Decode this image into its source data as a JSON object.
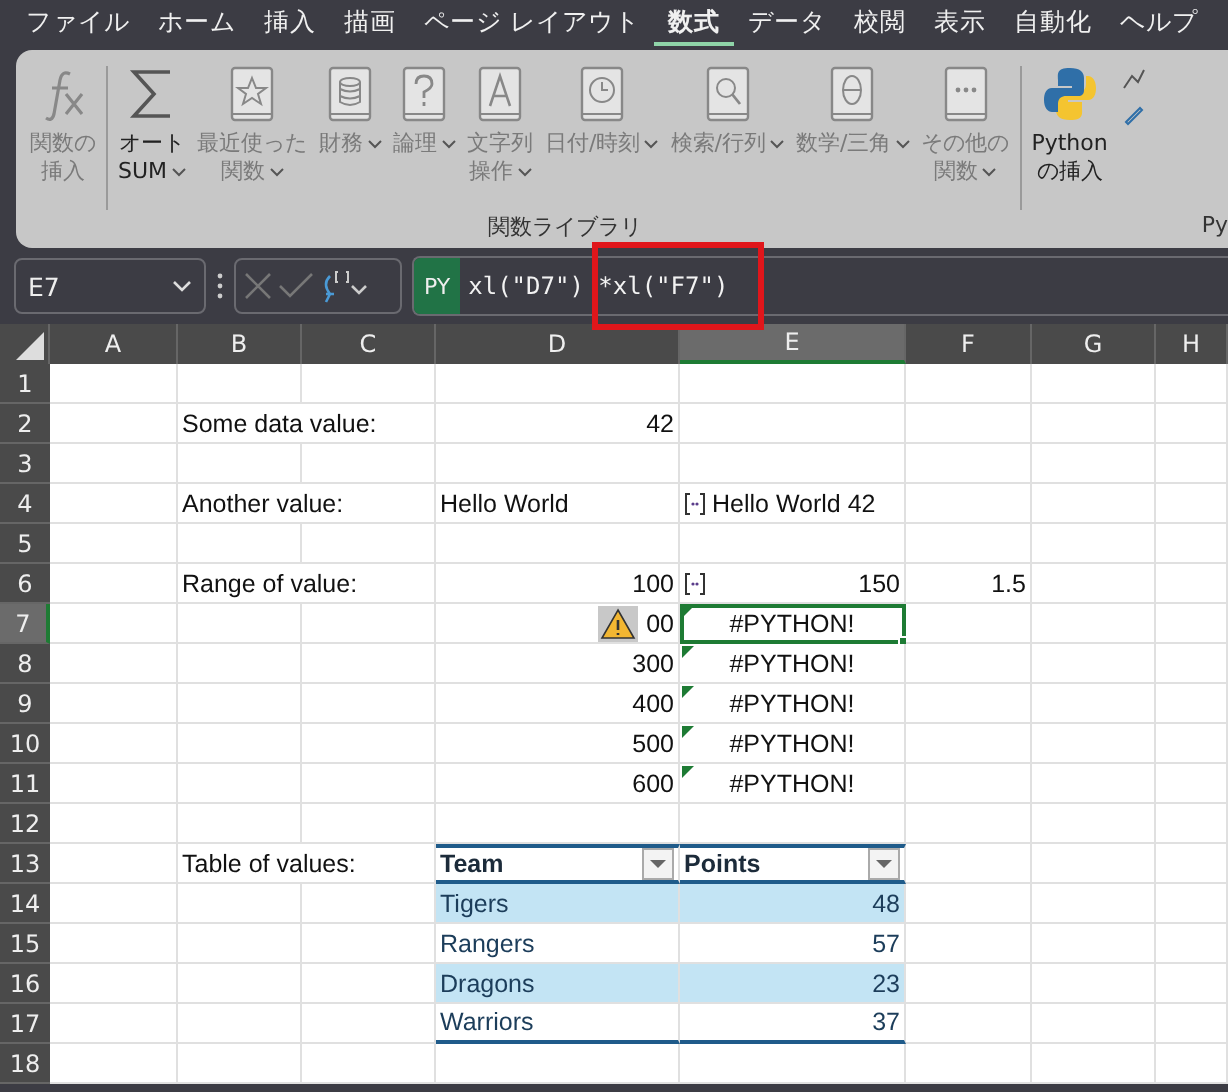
{
  "menu": [
    {
      "label": "ファイル",
      "selected": false
    },
    {
      "label": "ホーム",
      "selected": false
    },
    {
      "label": "挿入",
      "selected": false
    },
    {
      "label": "描画",
      "selected": false
    },
    {
      "label": "ページ レイアウト",
      "selected": false
    },
    {
      "label": "数式",
      "selected": true
    },
    {
      "label": "データ",
      "selected": false
    },
    {
      "label": "校閲",
      "selected": false
    },
    {
      "label": "表示",
      "selected": false
    },
    {
      "label": "自動化",
      "selected": false
    },
    {
      "label": "ヘルプ",
      "selected": false
    }
  ],
  "ribbon": {
    "items": [
      {
        "kind": "fx",
        "lines": [
          "関数の",
          "挿入"
        ],
        "dropdown": false,
        "disabled": true,
        "divider_after": true
      },
      {
        "kind": "sum",
        "lines": [
          "オート",
          "SUM"
        ],
        "dropdown": true,
        "disabled": false,
        "divider_after": false
      },
      {
        "kind": "star",
        "lines": [
          "最近使った",
          "関数"
        ],
        "dropdown": true,
        "disabled": true,
        "divider_after": false
      },
      {
        "kind": "database",
        "lines": [
          "財務"
        ],
        "dropdown": true,
        "disabled": true,
        "divider_after": false
      },
      {
        "kind": "question",
        "lines": [
          "論理"
        ],
        "dropdown": true,
        "disabled": true,
        "divider_after": false
      },
      {
        "kind": "letter",
        "lines": [
          "文字列",
          "操作"
        ],
        "dropdown": true,
        "disabled": true,
        "divider_after": false
      },
      {
        "kind": "clock",
        "lines": [
          "日付/時刻"
        ],
        "dropdown": true,
        "disabled": true,
        "divider_after": false
      },
      {
        "kind": "search",
        "lines": [
          "検索/行列"
        ],
        "dropdown": true,
        "disabled": true,
        "divider_after": false
      },
      {
        "kind": "theta",
        "lines": [
          "数学/三角"
        ],
        "dropdown": true,
        "disabled": true,
        "divider_after": false
      },
      {
        "kind": "dots",
        "lines": [
          "その他の",
          "関数"
        ],
        "dropdown": true,
        "disabled": true,
        "divider_after": true
      },
      {
        "kind": "python",
        "lines": [
          "Python",
          "の挿入"
        ],
        "dropdown": false,
        "disabled": false,
        "divider_after": false
      }
    ],
    "group_label": "関数ライブラリ",
    "next_group_label": "Py"
  },
  "formula_bar": {
    "name_box": "E7",
    "badge": "PY",
    "formula": "xl(\"D7\") *xl(\"F7\")",
    "highlight": true
  },
  "columns": [
    {
      "label": "A",
      "selected": false
    },
    {
      "label": "B",
      "selected": false
    },
    {
      "label": "C",
      "selected": false
    },
    {
      "label": "D",
      "selected": false
    },
    {
      "label": "E",
      "selected": true
    },
    {
      "label": "F",
      "selected": false
    },
    {
      "label": "G",
      "selected": false
    },
    {
      "label": "H",
      "selected": false
    }
  ],
  "rows": [
    {
      "number": "1",
      "selected": false,
      "cells": {}
    },
    {
      "number": "2",
      "selected": false,
      "cells": {
        "B": {
          "text": "Some data value:",
          "kind": "label"
        },
        "D": {
          "text": "42",
          "kind": "number"
        }
      }
    },
    {
      "number": "3",
      "selected": false,
      "cells": {}
    },
    {
      "number": "4",
      "selected": false,
      "cells": {
        "B": {
          "text": "Another value:",
          "kind": "label"
        },
        "D": {
          "text": "Hello World",
          "kind": "text"
        },
        "E": {
          "text": "Hello World 42",
          "kind": "python-text"
        }
      }
    },
    {
      "number": "5",
      "selected": false,
      "cells": {}
    },
    {
      "number": "6",
      "selected": false,
      "cells": {
        "B": {
          "text": "Range of value:",
          "kind": "label"
        },
        "D": {
          "text": "100",
          "kind": "number"
        },
        "E": {
          "text": "150",
          "kind": "python-number"
        },
        "F": {
          "text": "1.5",
          "kind": "number"
        }
      }
    },
    {
      "number": "7",
      "selected": true,
      "cells": {
        "D": {
          "text": "00",
          "kind": "number",
          "warning": true
        },
        "E": {
          "text": "#PYTHON!",
          "kind": "error",
          "active": true
        }
      }
    },
    {
      "number": "8",
      "selected": false,
      "cells": {
        "D": {
          "text": "300",
          "kind": "number"
        },
        "E": {
          "text": "#PYTHON!",
          "kind": "error"
        }
      }
    },
    {
      "number": "9",
      "selected": false,
      "cells": {
        "D": {
          "text": "400",
          "kind": "number"
        },
        "E": {
          "text": "#PYTHON!",
          "kind": "error"
        }
      }
    },
    {
      "number": "10",
      "selected": false,
      "cells": {
        "D": {
          "text": "500",
          "kind": "number"
        },
        "E": {
          "text": "#PYTHON!",
          "kind": "error"
        }
      }
    },
    {
      "number": "11",
      "selected": false,
      "cells": {
        "D": {
          "text": "600",
          "kind": "number"
        },
        "E": {
          "text": "#PYTHON!",
          "kind": "error"
        }
      }
    },
    {
      "number": "12",
      "selected": false,
      "cells": {}
    },
    {
      "number": "13",
      "selected": false,
      "cells": {
        "B": {
          "text": "Table of values:",
          "kind": "label"
        },
        "D": {
          "text": "Team",
          "kind": "table-header"
        },
        "E": {
          "text": "Points",
          "kind": "table-header"
        }
      }
    },
    {
      "number": "14",
      "selected": false,
      "banded": true,
      "cells": {
        "D": {
          "text": "Tigers",
          "kind": "table-text"
        },
        "E": {
          "text": "48",
          "kind": "table-number"
        }
      }
    },
    {
      "number": "15",
      "selected": false,
      "banded": false,
      "cells": {
        "D": {
          "text": "Rangers",
          "kind": "table-text"
        },
        "E": {
          "text": "57",
          "kind": "table-number"
        }
      }
    },
    {
      "number": "16",
      "selected": false,
      "banded": true,
      "cells": {
        "D": {
          "text": "Dragons",
          "kind": "table-text"
        },
        "E": {
          "text": "23",
          "kind": "table-number"
        }
      }
    },
    {
      "number": "17",
      "selected": false,
      "banded": false,
      "cells": {
        "D": {
          "text": "Warriors",
          "kind": "table-text"
        },
        "E": {
          "text": "37",
          "kind": "table-number"
        }
      }
    },
    {
      "number": "18",
      "selected": false,
      "cells": {}
    }
  ]
}
